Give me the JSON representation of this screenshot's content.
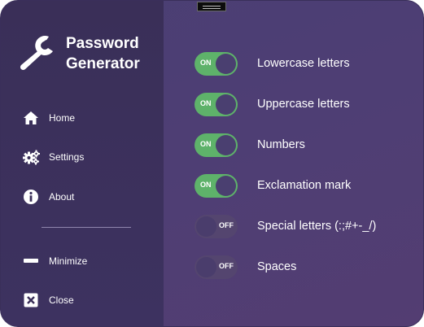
{
  "app": {
    "title": "Password\nGenerator"
  },
  "sidebar": {
    "items": [
      {
        "label": "Home",
        "icon": "home-icon"
      },
      {
        "label": "Settings",
        "icon": "gears-icon"
      },
      {
        "label": "About",
        "icon": "info-icon"
      },
      {
        "label": "Minimize",
        "icon": "minimize-icon"
      },
      {
        "label": "Close",
        "icon": "close-icon"
      }
    ]
  },
  "options": [
    {
      "label": "Lowercase letters",
      "state": "ON"
    },
    {
      "label": "Uppercase letters",
      "state": "ON"
    },
    {
      "label": "Numbers",
      "state": "ON"
    },
    {
      "label": "Exclamation mark",
      "state": "ON"
    },
    {
      "label": "Special letters (:;#+-_/)",
      "state": "OFF"
    },
    {
      "label": "Spaces",
      "state": "OFF"
    }
  ],
  "colors": {
    "toggle_on": "#5eb26a",
    "toggle_off": "#54456f",
    "sidebar_bg": "#3a2f58",
    "main_bg": "#4a3f73"
  }
}
